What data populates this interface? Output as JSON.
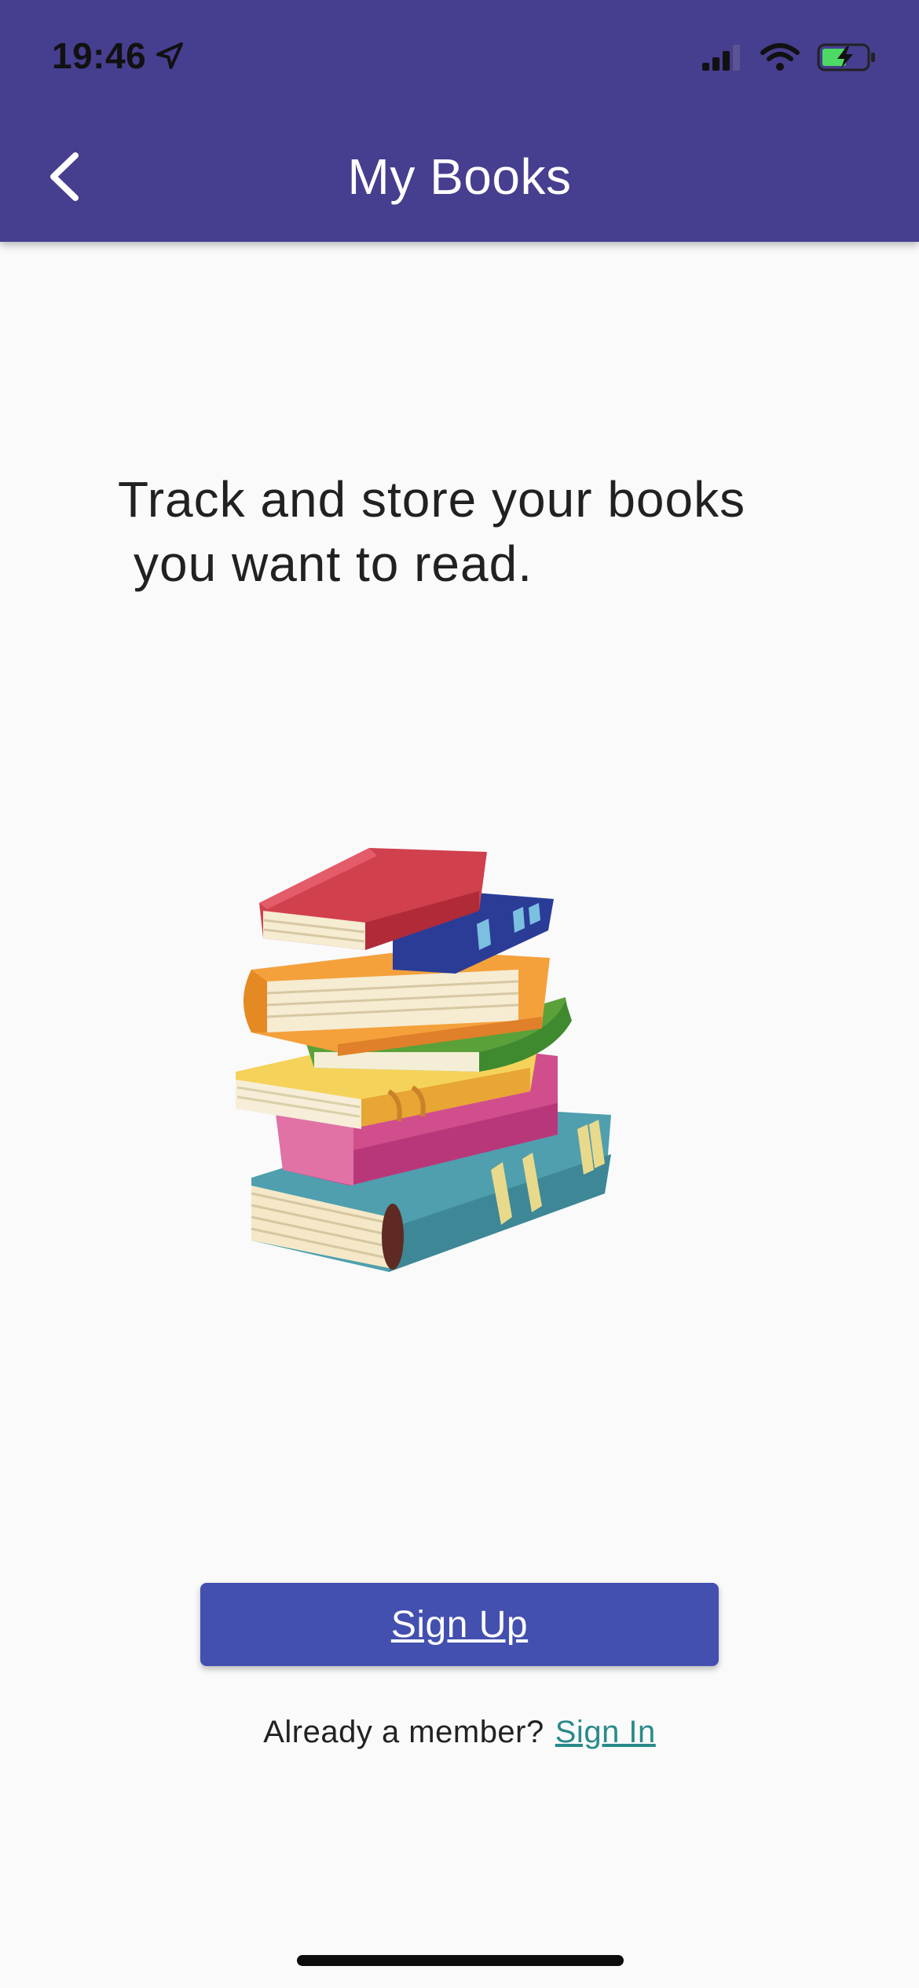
{
  "status_bar": {
    "time": "19:46",
    "icons": [
      "location-arrow-icon",
      "cellular-signal-icon",
      "wifi-icon",
      "battery-charging-icon"
    ]
  },
  "appbar": {
    "title": "My Books",
    "back_icon": "chevron-left-icon",
    "background": "#463e8f"
  },
  "content": {
    "tagline_line1": "Track and store your books",
    "tagline_line2": "you want to read.",
    "illustration": "stack-of-books-illustration"
  },
  "actions": {
    "signup_label": "Sign Up",
    "signup_color": "#4350b0",
    "member_prompt": "Already a member?",
    "signin_label": "Sign In",
    "link_color": "#2a8a8a"
  }
}
